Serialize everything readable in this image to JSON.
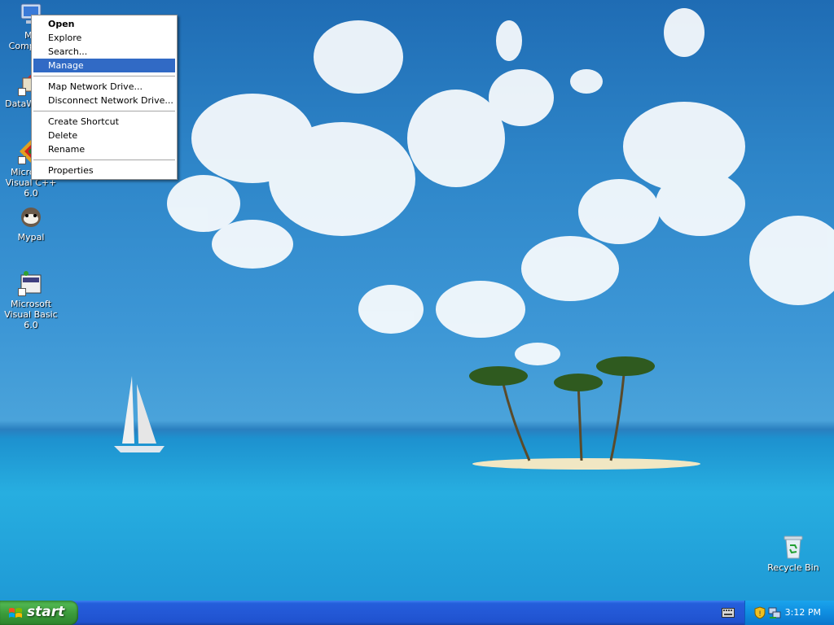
{
  "desktop": {
    "icons": [
      {
        "label": "My Computer"
      },
      {
        "label": "DataWizard"
      },
      {
        "label": "Microsoft Visual C++ 6.0"
      },
      {
        "label": "Mypal"
      },
      {
        "label": "Microsoft Visual Basic 6.0"
      },
      {
        "label": "Recycle Bin"
      }
    ]
  },
  "context_menu": {
    "items": [
      {
        "label": "Open"
      },
      {
        "label": "Explore"
      },
      {
        "label": "Search..."
      },
      {
        "label": "Manage"
      },
      {
        "label": "Map Network Drive..."
      },
      {
        "label": "Disconnect Network Drive..."
      },
      {
        "label": "Create Shortcut"
      },
      {
        "label": "Delete"
      },
      {
        "label": "Rename"
      },
      {
        "label": "Properties"
      }
    ],
    "highlighted": "Manage"
  },
  "taskbar": {
    "start_label": "start",
    "clock": "3:12 PM",
    "tray_icons": [
      "keyboard-icon",
      "security-shield-icon",
      "network-icon"
    ]
  },
  "colors": {
    "taskbar": "#245edb",
    "start_button": "#3a9a3a",
    "selection": "#316ac5"
  }
}
